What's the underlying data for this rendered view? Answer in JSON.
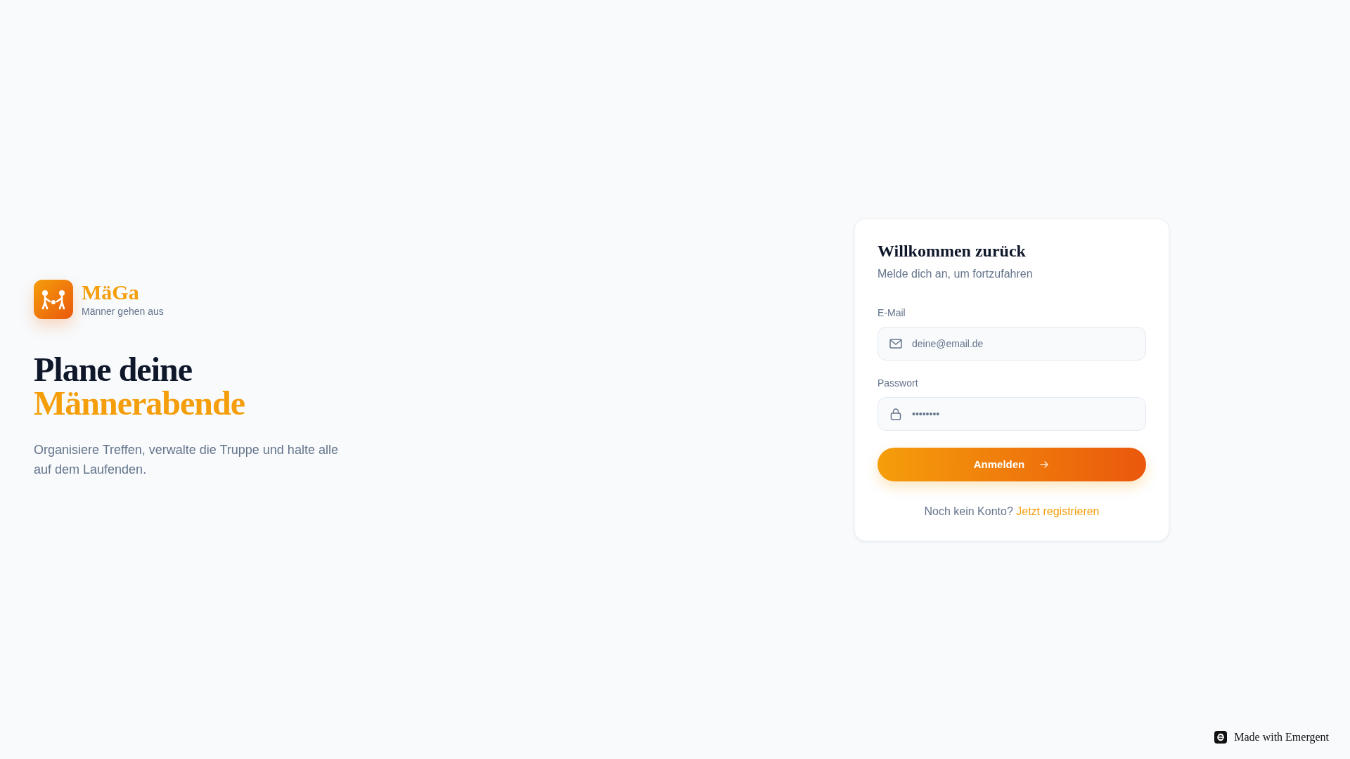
{
  "brand": {
    "name": "MäGa",
    "tagline": "Männer gehen aus"
  },
  "hero": {
    "heading_line1": "Plane deine",
    "heading_line2": "Männerabende",
    "description": "Organisiere Treffen, verwalte die Truppe und halte alle auf dem Laufenden."
  },
  "login_card": {
    "title": "Willkommen zurück",
    "subtitle": "Melde dich an, um fortzufahren",
    "fields": [
      {
        "kind": "email",
        "label": "E-Mail",
        "placeholder": "deine@email.de"
      },
      {
        "kind": "password",
        "label": "Passwort",
        "placeholder": "••••••••"
      }
    ],
    "submit_button": "Anmelden",
    "footer_text": "Noch kein Konto?",
    "register_link": "Jetzt registrieren"
  },
  "badge": {
    "label": "Made with Emergent"
  }
}
